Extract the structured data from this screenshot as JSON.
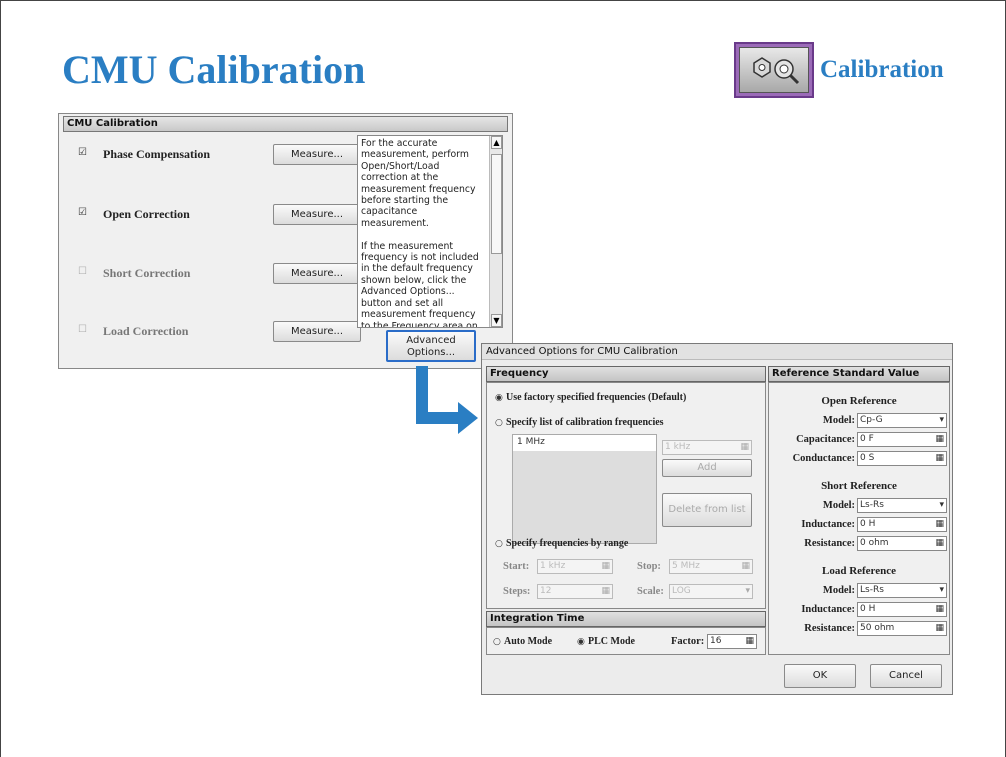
{
  "slide": {
    "title": "CMU Calibration",
    "badge_label": "Calibration",
    "badge_icon": "calibration-tool-icon"
  },
  "panel": {
    "header": "CMU Calibration",
    "rows": [
      {
        "label": "Phase Compensation",
        "checked": true,
        "button": "Measure..."
      },
      {
        "label": "Open Correction",
        "checked": true,
        "button": "Measure..."
      },
      {
        "label": "Short Correction",
        "checked": false,
        "button": "Measure..."
      },
      {
        "label": "Load Correction",
        "checked": false,
        "button": "Measure..."
      }
    ],
    "check_on": "☑",
    "check_off": "☐",
    "info_text": "For the accurate measurement, perform Open/Short/Load correction at the measurement frequency before starting the capacitance measurement.\n\nIf the measurement frequency is not included in the default frequency shown below, click the Advanced Options... button and set all measurement frequency to the Frequency area on the Advanced Options for CMU Calibration window.",
    "advanced_button": "Advanced\nOptions..."
  },
  "dialog": {
    "title": "Advanced Options for CMU Calibration",
    "frequency": {
      "header": "Frequency",
      "opt_default": "Use factory specified frequencies (Default)",
      "opt_list": "Specify list of calibration frequencies",
      "list_items": [
        "1 MHz"
      ],
      "list_input": "1 kHz",
      "add_button": "Add",
      "delete_button": "Delete from list",
      "opt_range": "Specify frequencies by range",
      "start_label": "Start:",
      "start_value": "1 kHz",
      "stop_label": "Stop:",
      "stop_value": "5 MHz",
      "steps_label": "Steps:",
      "steps_value": "12",
      "scale_label": "Scale:",
      "scale_value": "LOG"
    },
    "integration": {
      "header": "Integration Time",
      "auto_mode": "Auto Mode",
      "plc_mode": "PLC Mode",
      "factor_label": "Factor:",
      "factor_value": "16"
    },
    "reference": {
      "header": "Reference Standard Value",
      "open": {
        "title": "Open Reference",
        "model_label": "Model:",
        "model_value": "Cp-G",
        "p1_label": "Capacitance:",
        "p1_value": "0 F",
        "p2_label": "Conductance:",
        "p2_value": "0 S"
      },
      "short": {
        "title": "Short Reference",
        "model_label": "Model:",
        "model_value": "Ls-Rs",
        "p1_label": "Inductance:",
        "p1_value": "0 H",
        "p2_label": "Resistance:",
        "p2_value": "0 ohm"
      },
      "load": {
        "title": "Load Reference",
        "model_label": "Model:",
        "model_value": "Ls-Rs",
        "p1_label": "Inductance:",
        "p1_value": "0 H",
        "p2_label": "Resistance:",
        "p2_value": "50 ohm"
      }
    },
    "ok_button": "OK",
    "cancel_button": "Cancel",
    "radio_on": "◉",
    "radio_off": "○",
    "dropdown_glyph": "▾",
    "spin_glyph": "▦"
  },
  "colors": {
    "title_blue": "#2a7ec3",
    "arrow_blue": "#2a7ec3",
    "badge_purple": "#9b6bb8"
  }
}
